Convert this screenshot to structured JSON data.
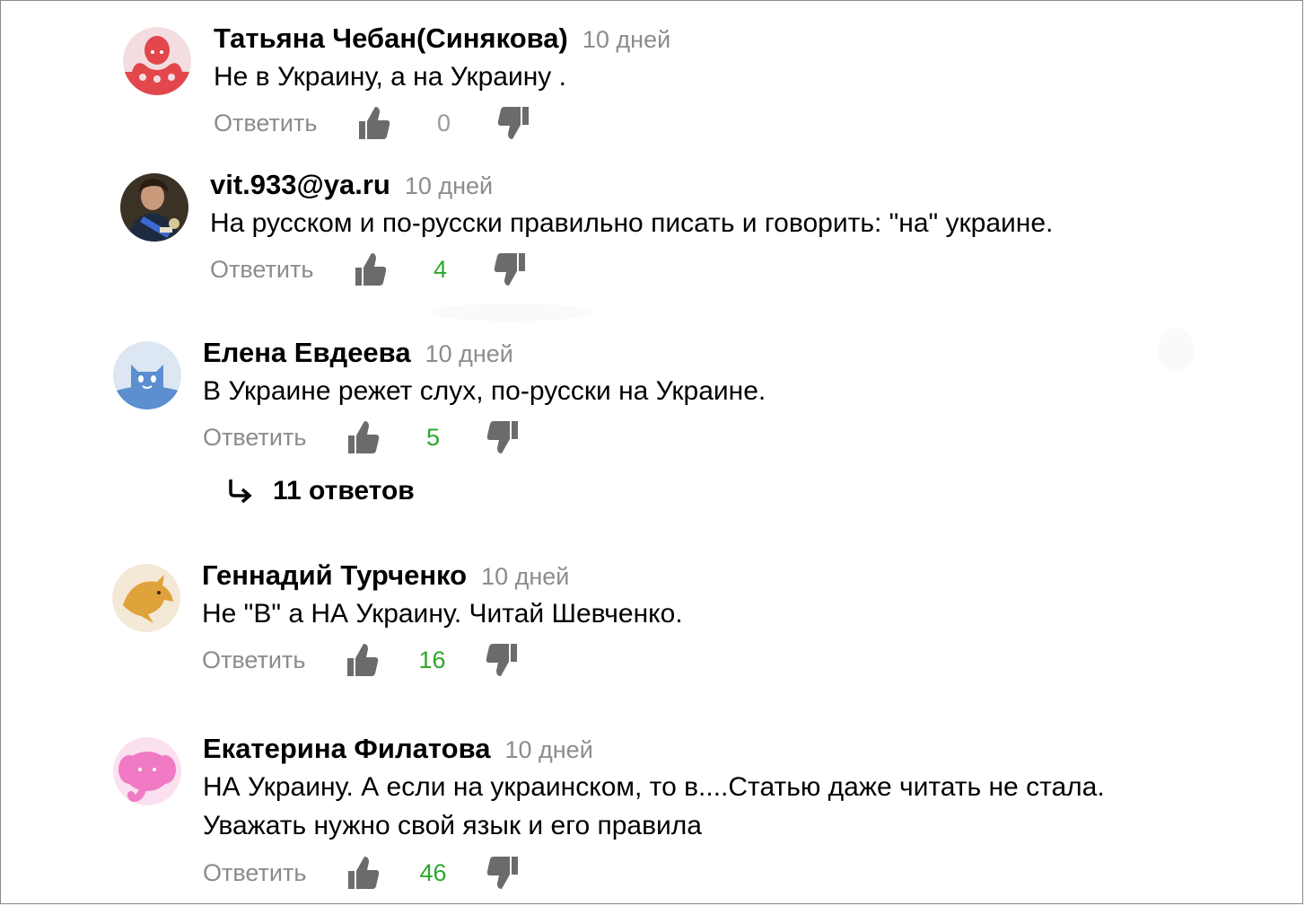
{
  "comments": [
    {
      "author": "Татьяна Чебан(Синякова)",
      "time": "10 дней",
      "text": [
        "Не в Украину, а на Украину ."
      ],
      "reply_label": "Ответить",
      "likes": "0",
      "avatar": "octopus-avatar",
      "avatar_color": "#e2474c"
    },
    {
      "author": "vit.933@ya.ru",
      "time": "10 дней",
      "text": [
        "На русском и по-русски правильно писать и говорить: \"на\" украине."
      ],
      "reply_label": "Ответить",
      "likes": "4",
      "avatar": "portrait-avatar",
      "avatar_color": "#3b3226"
    },
    {
      "author": "Елена Евдеева",
      "time": "10 дней",
      "text": [
        "В Украине режет слух, по-русски на Украине."
      ],
      "reply_label": "Ответить",
      "likes": "5",
      "avatar": "cat-avatar",
      "avatar_color": "#5b8fd0",
      "replies_label": "11 ответов"
    },
    {
      "author": "Геннадий Турченко",
      "time": "10 дней",
      "text": [
        "Не \"В\" а НА Украину. Читай Шевченко."
      ],
      "reply_label": "Ответить",
      "likes": "16",
      "avatar": "dolphin-avatar",
      "avatar_color": "#e0a23a"
    },
    {
      "author": "Екатерина Филатова",
      "time": "10 дней",
      "text": [
        "НА Украину. А если на украинском, то в....Статью даже читать не стала.",
        "Уважать нужно свой язык и его правила"
      ],
      "reply_label": "Ответить",
      "likes": "46",
      "avatar": "elephant-avatar",
      "avatar_color": "#f07bc4"
    }
  ],
  "colors": {
    "count_positive": "#2ca82c",
    "count_zero": "#9a9a9a",
    "muted_text": "#8c8c8c",
    "thumb_icon": "#6b6b6b"
  },
  "icons": {
    "like": "thumbs-up-icon",
    "dislike": "thumbs-down-icon",
    "replies": "reply-arrow-icon"
  }
}
